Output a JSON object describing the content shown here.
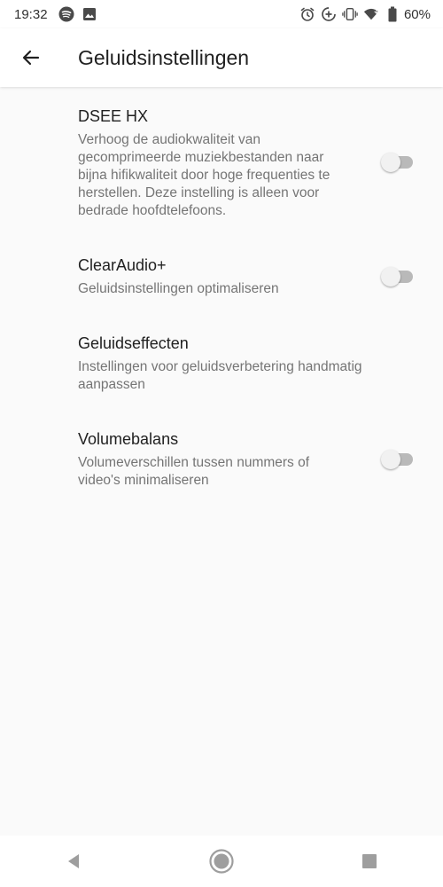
{
  "status_bar": {
    "time": "19:32",
    "battery": "60%",
    "left_icons": [
      "spotify-icon",
      "image-icon"
    ],
    "right_icons": [
      "alarm-icon",
      "data-saver-icon",
      "vibrate-icon",
      "wifi-icon",
      "battery-icon"
    ]
  },
  "app_bar": {
    "title": "Geluidsinstellingen",
    "back_icon": "arrow-left-icon"
  },
  "settings": [
    {
      "title": "DSEE HX",
      "description": "Verhoog de audiokwaliteit van gecomprimeerde muziekbestanden naar bijna hifikwaliteit door hoge frequenties te herstellen. Deze instelling is alleen voor bedrade hoofdtelefoons.",
      "toggle": "off"
    },
    {
      "title": "ClearAudio+",
      "description": "Geluidsinstellingen optimaliseren",
      "toggle": "off"
    },
    {
      "title": "Geluidseffecten",
      "description": "Instellingen voor geluidsverbetering handmatig aanpassen"
    },
    {
      "title": "Volumebalans",
      "description": "Volumeverschillen tussen nummers of video's minimaliseren",
      "toggle": "off"
    }
  ],
  "nav_bar": {
    "icons": [
      "back-triangle-icon",
      "home-circle-icon",
      "recents-square-icon"
    ]
  },
  "colors": {
    "background": "#fafafa",
    "title_text": "#212121",
    "secondary_text": "#757575",
    "toggle_track_off": "#b9b9b9",
    "toggle_thumb_off": "#f1f1f1"
  }
}
